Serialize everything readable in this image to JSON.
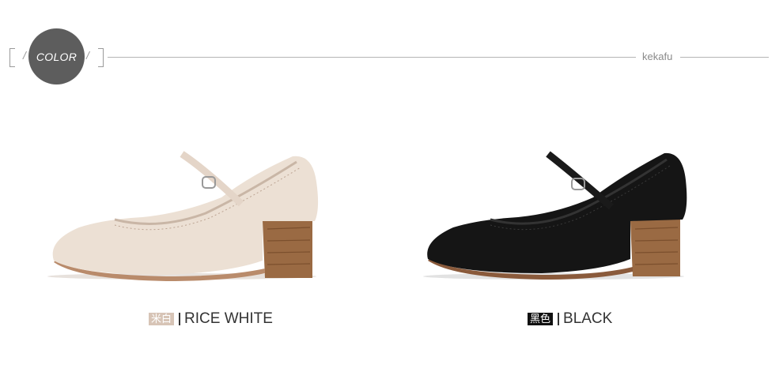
{
  "header": {
    "section_label": "COLOR",
    "brand": "kekafu"
  },
  "products": [
    {
      "color_cn": "米白",
      "color_en": "RICE WHITE",
      "tag_color": "#d7c4b6",
      "shoe_color": "#ece0d4"
    },
    {
      "color_cn": "黑色",
      "color_en": "BLACK",
      "tag_color": "#111111",
      "shoe_color": "#151515"
    }
  ],
  "colors": {
    "circle": "#5d5d5d",
    "rule": "#b4b4b4",
    "heel": "#9a6a43"
  }
}
